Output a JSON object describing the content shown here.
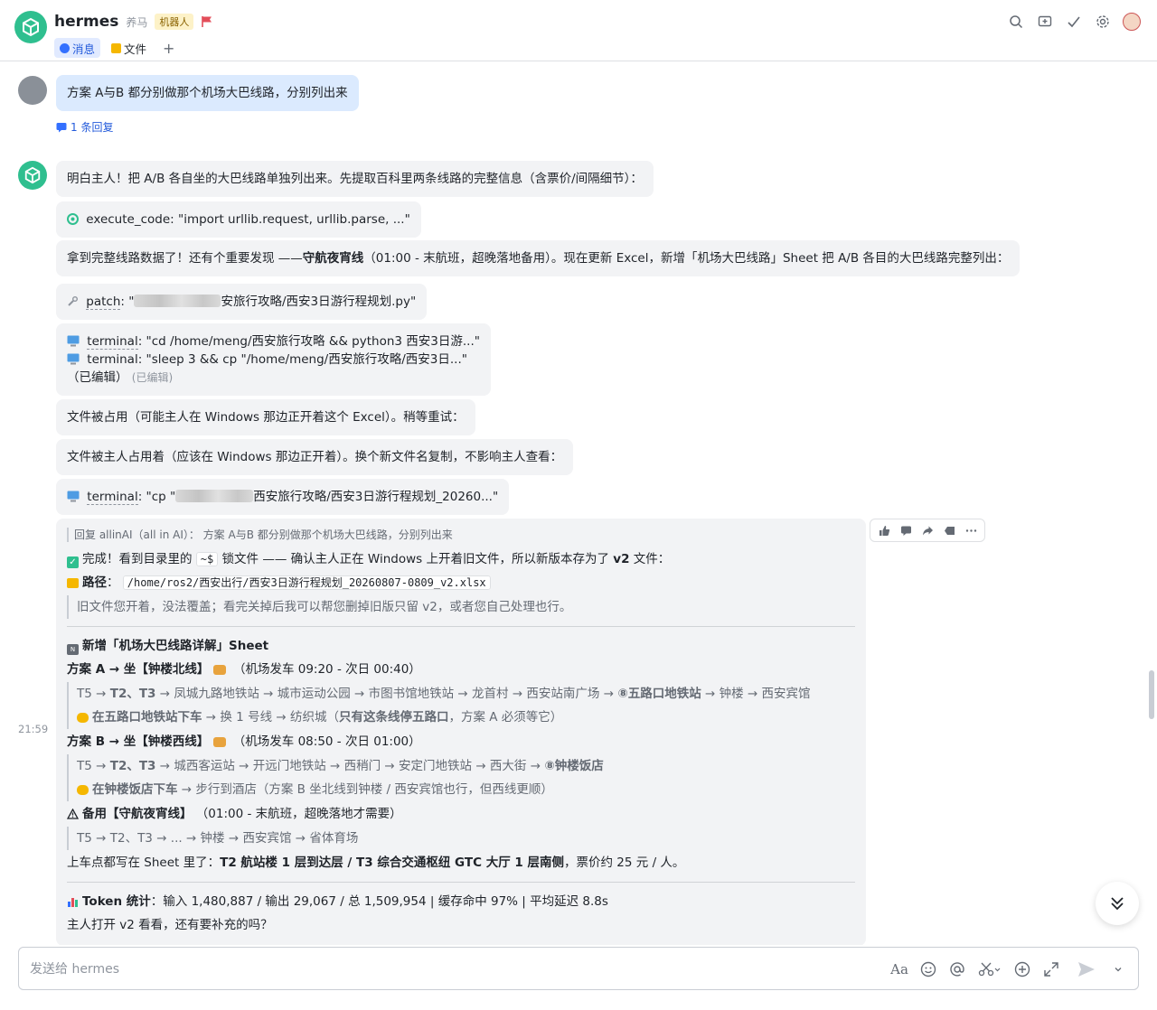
{
  "header": {
    "title": "hermes",
    "subtitle": "养马",
    "bot_tag": "机器人",
    "tabs": [
      {
        "label": "消息"
      },
      {
        "label": "文件"
      }
    ],
    "add_tab": "+"
  },
  "messages": {
    "user_msg": "方案 A与B 都分别做那个机场大巴线路，分别列出来",
    "reply_count": "1 条回复",
    "m1": "明白主人！把 A/B 各自坐的大巴线路单独列出来。先提取百科里两条线路的完整信息（含票价/间隔细节）：",
    "m2_label": "execute_code",
    "m2_text": ": \"import urllib.request, urllib.parse, ...\"",
    "m3_pre": "拿到完整线路数据了！还有个重要发现 ——",
    "m3_bold": "守航夜宵线",
    "m3_post": "（01:00 - 末航班，超晚落地备用）。现在更新 Excel，新增「机场大巴线路」Sheet 把 A/B 各目的大巴线路完整列出：",
    "m4_label": "patch",
    "m4_pre": ": \"",
    "m4_post": "安旅行攻略/西安3日游行程规划.py\"",
    "m5_label1": "terminal",
    "m5_text1": ": \"cd /home/meng/西安旅行攻略 && python3 西安3日游...\"",
    "m5_label2": "terminal",
    "m5_text2": ": \"sleep 3 && cp \"/home/meng/西安旅行攻略/西安3日...\"",
    "m5_edited": "（已编辑）",
    "m5_edited_tag": "(已编辑)",
    "m6": "文件被占用（可能主人在 Windows 那边正开着这个 Excel）。稍等重试：",
    "m7": "文件被主人占用着（应该在 Windows 那边正开着）。换个新文件名复制，不影响主人查看：",
    "m8_label": "terminal",
    "m8_pre": ": \"cp \"",
    "m8_post": "西安旅行攻略/西安3日游行程规划_20260...\""
  },
  "final": {
    "reply_quote": "回复 allinAI（all in AI）： 方案 A与B 都分别做那个机场大巴线路，分别列出来",
    "done_pre": "完成！看到目录里的",
    "done_code": "~$",
    "done_mid": "锁文件 —— 确认主人正在 Windows 上开着旧文件，所以新版本存为了",
    "done_bold": "v2",
    "done_post": "文件：",
    "path_label": "路径",
    "path_value": "/home/ros2/西安出行/西安3日游行程规划_20260807-0809_v2.xlsx",
    "note": "旧文件您开着，没法覆盖；看完关掉后我可以帮您删掉旧版只留 v2，或者您自己处理也行。",
    "sheet_title": "新增「机场大巴线路详解」Sheet",
    "a_title": "方案 A → 坐【钟楼北线】",
    "a_time": "（机场发车 09:20 - 次日 00:40）",
    "a_route_pre": "T5 → ",
    "a_route_b1": "T2、T3",
    "a_route_mid": " → 凤城九路地铁站 → 城市运动公园 → 市图书馆地铁站 → 龙首村 → 西安站南广场 → ",
    "a_route_b2": "⑧五路口地铁站",
    "a_route_post": " → 钟楼 → 西安宾馆",
    "a_tip_pre": "在五路口地铁站下车",
    "a_tip_mid": " → 换 1 号线 → 纺织城（",
    "a_tip_b": "只有这条线停五路口",
    "a_tip_post": "，方案 A 必须等它）",
    "b_title": "方案 B → 坐【钟楼西线】",
    "b_time": "（机场发车 08:50 - 次日 01:00）",
    "b_route_pre": "T5 → ",
    "b_route_b1": "T2、T3",
    "b_route_mid": " → 城西客运站 → 开远门地铁站 → 西稍门 → 安定门地铁站 → 西大街 → ",
    "b_route_b2": "⑧钟楼饭店",
    "b_tip_pre": "在钟楼饭店下车",
    "b_tip_post": " → 步行到酒店（方案 B 坐北线到钟楼 / 西安宾馆也行，但西线更顺）",
    "c_title": "备用【守航夜宵线】",
    "c_time": "（01:00 - 末航班，超晚落地才需要）",
    "c_route": "T5 → T2、T3 → ... → 钟楼 → 西安宾馆 → 省体育场",
    "board_pre": "上车点都写在 Sheet 里了：",
    "board_bold": "T2 航站楼 1 层到达层 / T3 综合交通枢纽 GTC 大厅 1 层南侧",
    "board_post": "，票价约 25 元 / 人。",
    "token_label": "Token 统计",
    "token_text": "：输入 1,480,887 / 输出 29,067 / 总 1,509,954 | 缓存命中 97% | 平均延迟 8.8s",
    "closing": "主人打开 v2 看看，还有要补充的吗？"
  },
  "timestamp": "21:59",
  "composer": {
    "placeholder": "发送给 hermes"
  },
  "colors": {
    "brand": "#2fbf8f",
    "bubble": "#f2f3f5",
    "user_bubble": "#dbeafe",
    "link": "#245bdb"
  }
}
